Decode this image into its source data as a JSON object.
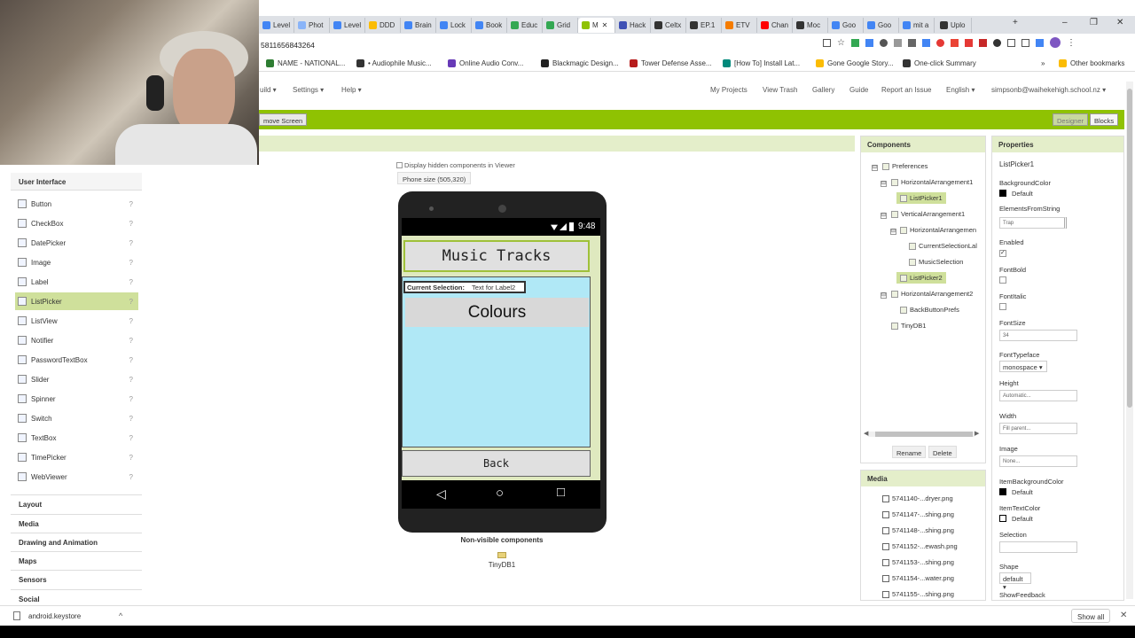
{
  "browser": {
    "tabs": [
      {
        "label": "Level",
        "color": "#4285f4"
      },
      {
        "label": "Phot",
        "color": "#8ab4f8"
      },
      {
        "label": "Level",
        "color": "#4285f4"
      },
      {
        "label": "DDD",
        "color": "#fbbc04"
      },
      {
        "label": "Brain",
        "color": "#4285f4"
      },
      {
        "label": "Lock",
        "color": "#4285f4"
      },
      {
        "label": "Book",
        "color": "#4285f4"
      },
      {
        "label": "Educ",
        "color": "#34a853"
      },
      {
        "label": "Grid",
        "color": "#34a853"
      },
      {
        "label": "M",
        "color": "#8fc202"
      },
      {
        "label": "Hack",
        "color": "#3f51b5"
      },
      {
        "label": "Celtx",
        "color": "#333333"
      },
      {
        "label": "EP.1",
        "color": "#333333"
      },
      {
        "label": "ETV",
        "color": "#f57c00"
      },
      {
        "label": "Chan",
        "color": "#ff0000"
      },
      {
        "label": "Moc",
        "color": "#333333"
      },
      {
        "label": "Goo",
        "color": "#4285f4"
      },
      {
        "label": "Goo",
        "color": "#4285f4"
      },
      {
        "label": "mit a",
        "color": "#4285f4"
      },
      {
        "label": "Uplo",
        "color": "#333333"
      }
    ],
    "new_tab": "+",
    "minimize": "–",
    "restore": "❐",
    "close": "✕",
    "url": "5811656843264",
    "bookmarks": [
      {
        "label": "NAME - NATIONAL...",
        "color": "#2e7d32"
      },
      {
        "label": "• Audiophile Music...",
        "color": "#333333"
      },
      {
        "label": "Online Audio Conv...",
        "color": "#673ab7"
      },
      {
        "label": "Blackmagic Design...",
        "color": "#222222"
      },
      {
        "label": "Tower Defense Asse...",
        "color": "#b71c1c"
      },
      {
        "label": "[How To] Install Lat...",
        "color": "#00897b"
      },
      {
        "label": "Gone Google Story...",
        "color": "#fbbc04"
      },
      {
        "label": "One-click Summary",
        "color": "#333333"
      }
    ],
    "more_bookmarks": "»",
    "other_bookmarks": "Other bookmarks"
  },
  "appinventor": {
    "menus": [
      "uild ▾",
      "Settings ▾",
      "Help ▾"
    ],
    "nav": [
      "My Projects",
      "View Trash",
      "Gallery",
      "Guide",
      "Report an Issue",
      "English ▾",
      "simpsonb@waihekehigh.school.nz ▾"
    ],
    "remove_screen": "move Screen",
    "designer": "Designer",
    "blocks": "Blocks"
  },
  "palette": {
    "user_interface": "User Interface",
    "items": [
      {
        "label": "Button",
        "selected": false
      },
      {
        "label": "CheckBox",
        "selected": false
      },
      {
        "label": "DatePicker",
        "selected": false
      },
      {
        "label": "Image",
        "selected": false
      },
      {
        "label": "Label",
        "selected": false
      },
      {
        "label": "ListPicker",
        "selected": true
      },
      {
        "label": "ListView",
        "selected": false
      },
      {
        "label": "Notifier",
        "selected": false
      },
      {
        "label": "PasswordTextBox",
        "selected": false
      },
      {
        "label": "Slider",
        "selected": false
      },
      {
        "label": "Spinner",
        "selected": false
      },
      {
        "label": "Switch",
        "selected": false
      },
      {
        "label": "TextBox",
        "selected": false
      },
      {
        "label": "TimePicker",
        "selected": false
      },
      {
        "label": "WebViewer",
        "selected": false
      }
    ],
    "help": "?",
    "categories": [
      "Layout",
      "Media",
      "Drawing and Animation",
      "Maps",
      "Sensors",
      "Social"
    ]
  },
  "viewer": {
    "hidden_components": "Display hidden components in Viewer",
    "phone_size": "Phone size (505,320)",
    "status_time": "9:48",
    "title": "Music Tracks",
    "current_selection_label": "Current Selection:",
    "current_selection_value": "Text for Label2",
    "colours_button": "Colours",
    "back_button": "Back",
    "nav_back": "◁",
    "nav_home": "○",
    "nav_recent": "□",
    "non_visible": "Non-visible components",
    "tinydb": "TinyDB1"
  },
  "components": {
    "title": "Components",
    "tree": [
      "Preferences",
      "HorizontalArrangement1",
      "ListPicker1",
      "VerticalArrangement1",
      "HorizontalArrangemen",
      "CurrentSelectionLal",
      "MusicSelection",
      "ListPicker2",
      "HorizontalArrangement2",
      "BackButtonPrefs",
      "TinyDB1"
    ],
    "toggle": "⊟",
    "rename": "Rename",
    "delete": "Delete"
  },
  "media": {
    "title": "Media",
    "files": [
      "5741140-...dryer.png",
      "5741147-...shing.png",
      "5741148-...shing.png",
      "5741152-...ewash.png",
      "5741153-...shing.png",
      "5741154-...water.png",
      "5741155-...shing.png"
    ]
  },
  "properties": {
    "title": "Properties",
    "component": "ListPicker1",
    "background_color_label": "BackgroundColor",
    "background_color_value": "Default",
    "elements_label": "ElementsFromString",
    "elements_value": "Trap",
    "enabled_label": "Enabled",
    "enabled_check": "✓",
    "fontbold_label": "FontBold",
    "fontitalic_label": "FontItalic",
    "fontsize_label": "FontSize",
    "fontsize_value": "34",
    "typeface_label": "FontTypeface",
    "typeface_value": "monospace ▾",
    "height_label": "Height",
    "height_value": "Automatic...",
    "width_label": "Width",
    "width_value": "Fill parent...",
    "image_label": "Image",
    "image_value": "None...",
    "item_bg_label": "ItemBackgroundColor",
    "item_bg_value": "Default",
    "item_text_label": "ItemTextColor",
    "item_text_value": "Default",
    "selection_label": "Selection",
    "shape_label": "Shape",
    "shape_value": "default ▾",
    "feedback_label": "ShowFeedback"
  },
  "status": {
    "download": "android.keystore",
    "show_all": "Show all",
    "close": "✕"
  }
}
